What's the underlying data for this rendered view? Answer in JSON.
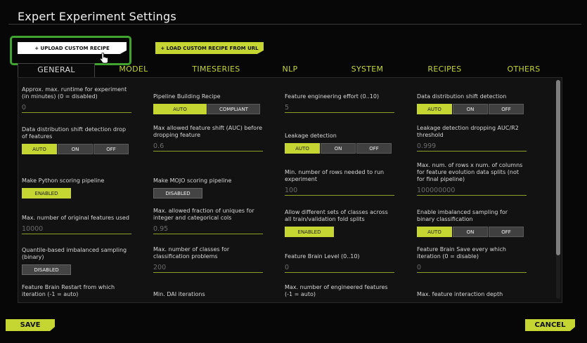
{
  "window": {
    "title": "Expert Experiment Settings"
  },
  "toolbar": {
    "upload_label": "+ UPLOAD CUSTOM RECIPE",
    "load_url_label": "+ LOAD CUSTOM RECIPE FROM URL"
  },
  "tabs": [
    {
      "label": "GENERAL",
      "active": true
    },
    {
      "label": "MODEL"
    },
    {
      "label": "TIMESERIES"
    },
    {
      "label": "NLP"
    },
    {
      "label": "SYSTEM"
    },
    {
      "label": "RECIPES"
    },
    {
      "label": "OTHERS"
    }
  ],
  "settings": {
    "max_runtime": {
      "label": "Approx. max. runtime for experiment (in minutes) (0 = disabled)",
      "value": "0"
    },
    "pipeline_recipe": {
      "label": "Pipeline Building Recipe",
      "options": [
        "AUTO",
        "COMPLIANT"
      ],
      "selected": "AUTO"
    },
    "fe_effort": {
      "label": "Feature engineering effort (0..10)",
      "value": "5"
    },
    "data_shift": {
      "label": "Data distribution shift detection",
      "options": [
        "AUTO",
        "ON",
        "OFF"
      ],
      "selected": "AUTO"
    },
    "data_shift_drop": {
      "label": "Data distribution shift detection drop of features",
      "options": [
        "AUTO",
        "ON",
        "OFF"
      ],
      "selected": "AUTO"
    },
    "max_shift_auc": {
      "label": "Max allowed feature shift (AUC) before dropping feature",
      "value": "0.6"
    },
    "leakage": {
      "label": "Leakage detection",
      "options": [
        "AUTO",
        "ON",
        "OFF"
      ],
      "selected": "AUTO"
    },
    "leakage_drop": {
      "label": "Leakage detection dropping AUC/R2 threshold",
      "value": "0.999"
    },
    "python_pipeline": {
      "label": "Make Python scoring pipeline",
      "state": "ENABLED"
    },
    "mojo_pipeline": {
      "label": "Make MOJO scoring pipeline",
      "state": "DISABLED"
    },
    "min_rows": {
      "label": "Min. number of rows needed to run experiment",
      "value": "100"
    },
    "max_rows_cols": {
      "label": "Max. num. of rows x num. of columns for feature evolution data splits (not for final pipeline)",
      "value": "100000000"
    },
    "max_orig_features": {
      "label": "Max. number of original features used",
      "value": "10000"
    },
    "max_unique_frac": {
      "label": "Max. allowed fraction of uniques for integer and categorical cols",
      "value": "0.95"
    },
    "diff_class_sets": {
      "label": "Allow different sets of classes across all train/validation fold splits",
      "state": "ENABLED"
    },
    "imbalanced_sampling": {
      "label": "Enable imbalanced sampling for binary classification",
      "options": [
        "AUTO",
        "ON",
        "OFF"
      ],
      "selected": "AUTO"
    },
    "quantile_sampling": {
      "label": "Quantile-based imbalanced sampling (binary)",
      "state": "DISABLED"
    },
    "max_classes": {
      "label": "Max. number of classes for classification problems",
      "value": "200"
    },
    "brain_level": {
      "label": "Feature Brain Level (0..10)",
      "value": "0"
    },
    "brain_save": {
      "label": "Feature Brain Save every which iteration (0 = disable)",
      "value": "0"
    },
    "brain_restart": {
      "label": "Feature Brain Restart from which iteration (-1 = auto)"
    },
    "min_dai_iter": {
      "label": "Min. DAI iterations"
    },
    "max_eng_features": {
      "label": "Max. number of engineered features (-1 = auto)"
    },
    "max_interaction": {
      "label": "Max. feature interaction depth"
    }
  },
  "footer": {
    "save_label": "SAVE",
    "cancel_label": "CANCEL"
  },
  "colors": {
    "accent": "#c5d633",
    "highlight": "#3fa52e",
    "background": "#070707"
  }
}
